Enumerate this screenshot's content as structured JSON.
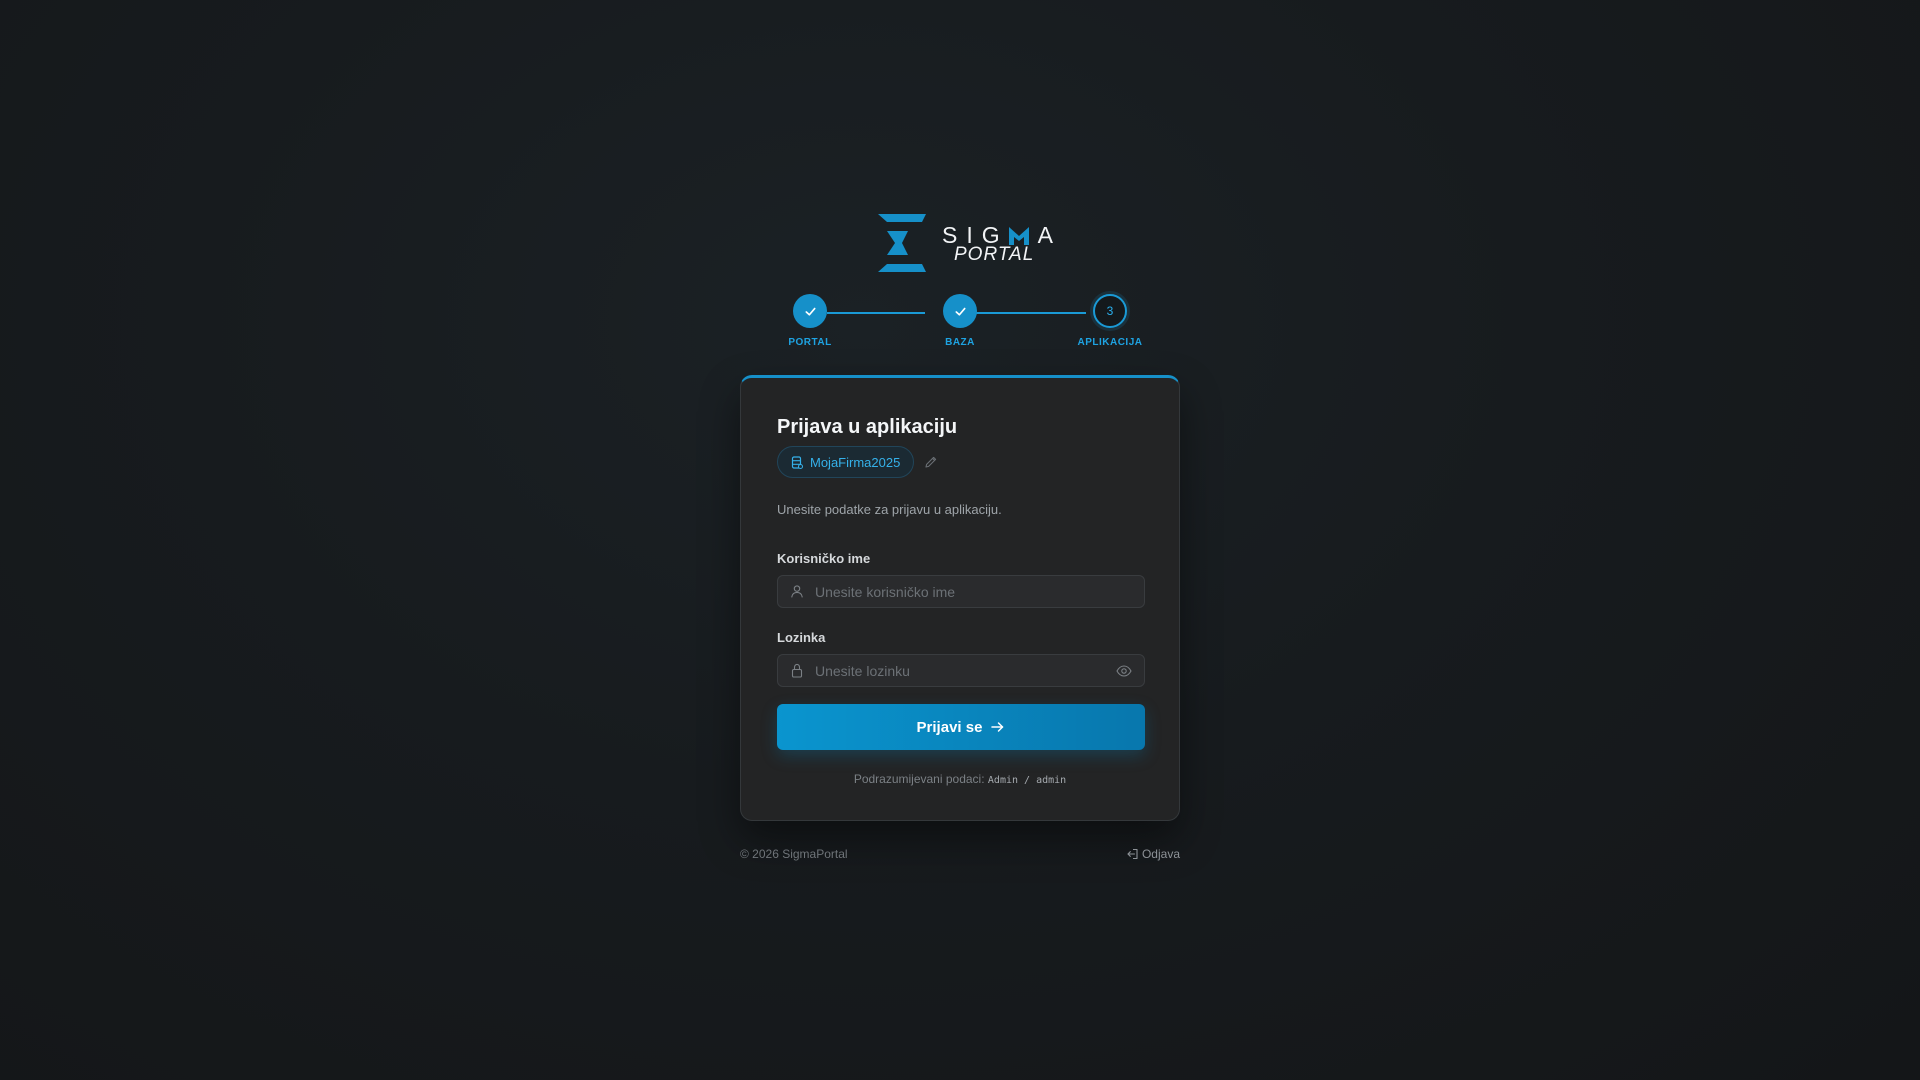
{
  "brand": {
    "wordmark": "SIGMA",
    "subtitle": "PORTAL",
    "accent_color": "#1690c9"
  },
  "stepper": {
    "steps": [
      {
        "label": "PORTAL",
        "status": "done",
        "icon": "check-icon"
      },
      {
        "label": "BAZA",
        "status": "done",
        "icon": "check-icon"
      },
      {
        "label": "APLIKACIJA",
        "status": "active",
        "number": "3"
      }
    ]
  },
  "card": {
    "title": "Prijava u aplikaciju",
    "database": {
      "name": "MojaFirma2025",
      "icon": "database-icon"
    },
    "subtitle": "Unesite podatke za prijavu u aplikaciju.",
    "username": {
      "label": "Korisničko ime",
      "placeholder": "Unesite korisničko ime",
      "value": "",
      "icon": "user-icon"
    },
    "password": {
      "label": "Lozinka",
      "placeholder": "Unesite lozinku",
      "value": "",
      "icon": "lock-icon",
      "toggle_icon": "eye-icon"
    },
    "submit_label": "Prijavi se",
    "defaults_prefix": "Podrazumijevani podaci:",
    "defaults_value": "Admin / admin"
  },
  "footer": {
    "copyright": "© 2026 SigmaPortal",
    "logout_label": "Odjava"
  }
}
